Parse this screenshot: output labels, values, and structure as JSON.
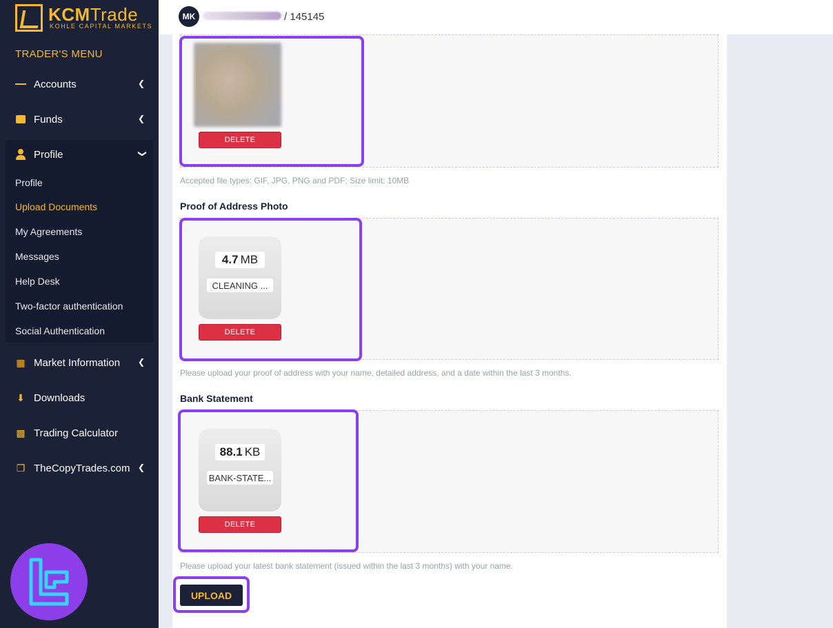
{
  "brand": {
    "name_kcm": "KCM",
    "name_trade": "Trade",
    "tagline": "KOHLE CAPITAL MARKETS"
  },
  "sidebar": {
    "title": "TRADER'S MENU",
    "items": [
      {
        "label": "Accounts",
        "icon": "list-icon"
      },
      {
        "label": "Funds",
        "icon": "wallet-icon"
      },
      {
        "label": "Profile",
        "icon": "user-icon"
      },
      {
        "label": "Market Information",
        "icon": "calendar-icon"
      },
      {
        "label": "Downloads",
        "icon": "download-icon"
      },
      {
        "label": "Trading Calculator",
        "icon": "calculator-icon"
      },
      {
        "label": "TheCopyTrades.com",
        "icon": "copy-icon"
      }
    ],
    "profile_subitems": [
      "Profile",
      "Upload Documents",
      "My Agreements",
      "Messages",
      "Help Desk",
      "Two-factor authentication",
      "Social Authentication"
    ]
  },
  "topbar": {
    "avatar_initials": "MK",
    "account_id": "/ 145145"
  },
  "documents": {
    "id_photo": {
      "delete_label": "DELETE",
      "hint": "Accepted file types: GIF, JPG, PNG and PDF; Size limit: 10MB"
    },
    "proof_of_address": {
      "label": "Proof of Address Photo",
      "file_size_value": "4.7",
      "file_size_unit": "MB",
      "file_name": "CLEANING ...",
      "delete_label": "DELETE",
      "hint": "Please upload your proof of address with your name, detailed address, and a date within the last 3 months."
    },
    "bank_statement": {
      "label": "Bank Statement",
      "file_size_value": "88.1",
      "file_size_unit": "KB",
      "file_name": "BANK-STATE...",
      "delete_label": "DELETE",
      "hint": "Please upload your latest bank statement (issued within the last 3 months) with your name."
    }
  },
  "upload_label": "UPLOAD",
  "colors": {
    "sidebar_bg": "#1b2238",
    "accent": "#f5b82e",
    "highlight": "#8a3ff0",
    "delete": "#dc3045"
  }
}
